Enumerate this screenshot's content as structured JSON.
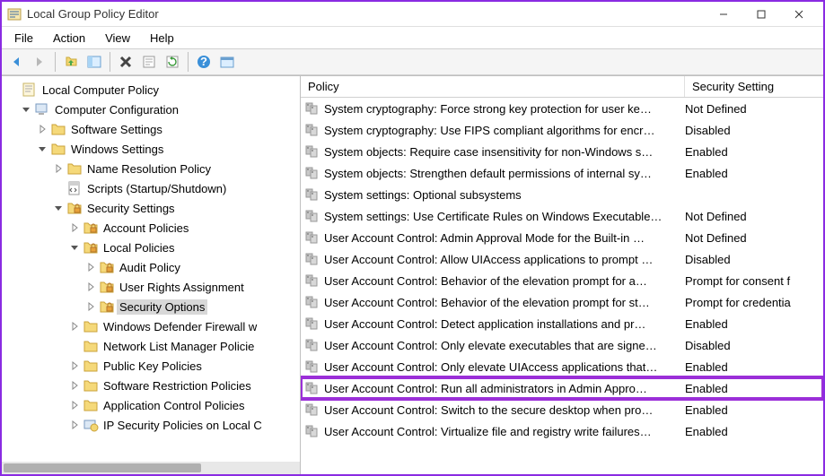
{
  "window": {
    "title": "Local Group Policy Editor"
  },
  "menu": {
    "file": "File",
    "action": "Action",
    "view": "View",
    "help": "Help"
  },
  "tree": [
    {
      "level": 1,
      "exp": "",
      "icon": "root",
      "label": "Local Computer Policy"
    },
    {
      "level": 2,
      "exp": "open",
      "icon": "computer",
      "label": "Computer Configuration"
    },
    {
      "level": 3,
      "exp": "closed",
      "icon": "folder",
      "label": "Software Settings"
    },
    {
      "level": 3,
      "exp": "open",
      "icon": "folder",
      "label": "Windows Settings"
    },
    {
      "level": 4,
      "exp": "closed",
      "icon": "folder",
      "label": "Name Resolution Policy"
    },
    {
      "level": 4,
      "exp": "",
      "icon": "script",
      "label": "Scripts (Startup/Shutdown)"
    },
    {
      "level": 4,
      "exp": "open",
      "icon": "secfolder",
      "label": "Security Settings"
    },
    {
      "level": 5,
      "exp": "closed",
      "icon": "secfolder",
      "label": "Account Policies"
    },
    {
      "level": 5,
      "exp": "open",
      "icon": "secfolder",
      "label": "Local Policies"
    },
    {
      "level": 6,
      "exp": "closed",
      "icon": "secfolder",
      "label": "Audit Policy"
    },
    {
      "level": 6,
      "exp": "closed",
      "icon": "secfolder",
      "label": "User Rights Assignment"
    },
    {
      "level": 6,
      "exp": "closed",
      "icon": "secfolder",
      "label": "Security Options",
      "selected": true
    },
    {
      "level": 5,
      "exp": "closed",
      "icon": "folder",
      "label": "Windows Defender Firewall w"
    },
    {
      "level": 5,
      "exp": "",
      "icon": "folder",
      "label": "Network List Manager Policie"
    },
    {
      "level": 5,
      "exp": "closed",
      "icon": "folder",
      "label": "Public Key Policies"
    },
    {
      "level": 5,
      "exp": "closed",
      "icon": "folder",
      "label": "Software Restriction Policies"
    },
    {
      "level": 5,
      "exp": "closed",
      "icon": "folder",
      "label": "Application Control Policies"
    },
    {
      "level": 5,
      "exp": "closed",
      "icon": "ipsec",
      "label": "IP Security Policies on Local C"
    }
  ],
  "columns": {
    "policy": "Policy",
    "setting": "Security Setting"
  },
  "rows": [
    {
      "p": "System cryptography: Force strong key protection for user ke…",
      "s": "Not Defined"
    },
    {
      "p": "System cryptography: Use FIPS compliant algorithms for encr…",
      "s": "Disabled"
    },
    {
      "p": "System objects: Require case insensitivity for non-Windows s…",
      "s": "Enabled"
    },
    {
      "p": "System objects: Strengthen default permissions of internal sy…",
      "s": "Enabled"
    },
    {
      "p": "System settings: Optional subsystems",
      "s": ""
    },
    {
      "p": "System settings: Use Certificate Rules on Windows Executable…",
      "s": "Not Defined"
    },
    {
      "p": "User Account Control: Admin Approval Mode for the Built-in …",
      "s": "Not Defined"
    },
    {
      "p": "User Account Control: Allow UIAccess applications to prompt …",
      "s": "Disabled"
    },
    {
      "p": "User Account Control: Behavior of the elevation prompt for a…",
      "s": "Prompt for consent f"
    },
    {
      "p": "User Account Control: Behavior of the elevation prompt for st…",
      "s": "Prompt for credentia"
    },
    {
      "p": "User Account Control: Detect application installations and pr…",
      "s": "Enabled"
    },
    {
      "p": "User Account Control: Only elevate executables that are signe…",
      "s": "Disabled"
    },
    {
      "p": "User Account Control: Only elevate UIAccess applications that…",
      "s": "Enabled"
    },
    {
      "p": "User Account Control: Run all administrators in Admin Appro…",
      "s": "Enabled",
      "hilite": true
    },
    {
      "p": "User Account Control: Switch to the secure desktop when pro…",
      "s": "Enabled"
    },
    {
      "p": "User Account Control: Virtualize file and registry write failures…",
      "s": "Enabled"
    }
  ]
}
